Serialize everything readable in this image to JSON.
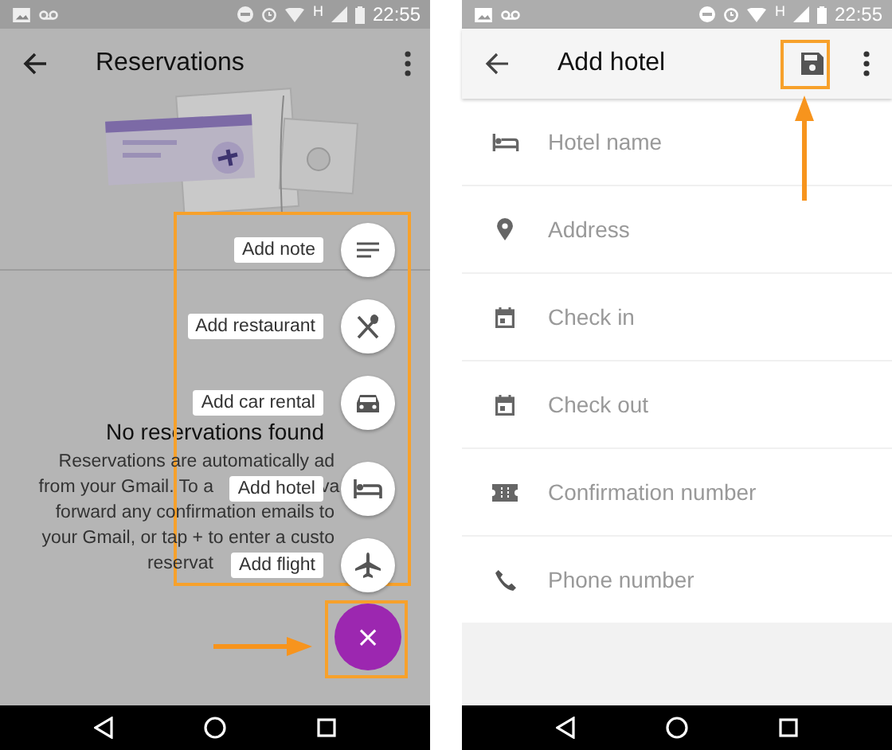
{
  "left_screen": {
    "status_bar": {
      "network": "H",
      "time": "22:55"
    },
    "toolbar": {
      "title": "Reservations"
    },
    "empty_state": {
      "heading": "No reservations found",
      "text_lines": [
        {
          "kind": "before_button",
          "parts": [
            "Reservations are automatically ad"
          ]
        },
        {
          "kind": "split",
          "parts": [
            "from your Gmail. To a",
            "va"
          ]
        },
        {
          "kind": "before_button",
          "parts": [
            "forward any confirmation emails to"
          ]
        },
        {
          "kind": "before_button",
          "parts": [
            "your Gmail, or tap + to enter a custo"
          ]
        },
        {
          "kind": "before_label",
          "parts": [
            "reservat"
          ]
        }
      ]
    },
    "fab_menu": [
      {
        "label": "Add note",
        "kind": "note"
      },
      {
        "label": "Add restaurant",
        "kind": "restaurant"
      },
      {
        "label": "Add car rental",
        "kind": "car"
      },
      {
        "label": "Add hotel",
        "kind": "hotel"
      },
      {
        "label": "Add flight",
        "kind": "flight"
      }
    ],
    "fab": {
      "symbol": "×"
    }
  },
  "right_screen": {
    "status_bar": {
      "network": "H",
      "time": "22:55"
    },
    "toolbar": {
      "title": "Add hotel"
    },
    "fields": [
      {
        "placeholder": "Hotel name",
        "kind": "hotel"
      },
      {
        "placeholder": "Address",
        "kind": "place"
      },
      {
        "placeholder": "Check in",
        "kind": "calendar"
      },
      {
        "placeholder": "Check out",
        "kind": "calendar"
      },
      {
        "placeholder": "Confirmation number",
        "kind": "ticket"
      },
      {
        "placeholder": "Phone number",
        "kind": "phone"
      }
    ]
  }
}
